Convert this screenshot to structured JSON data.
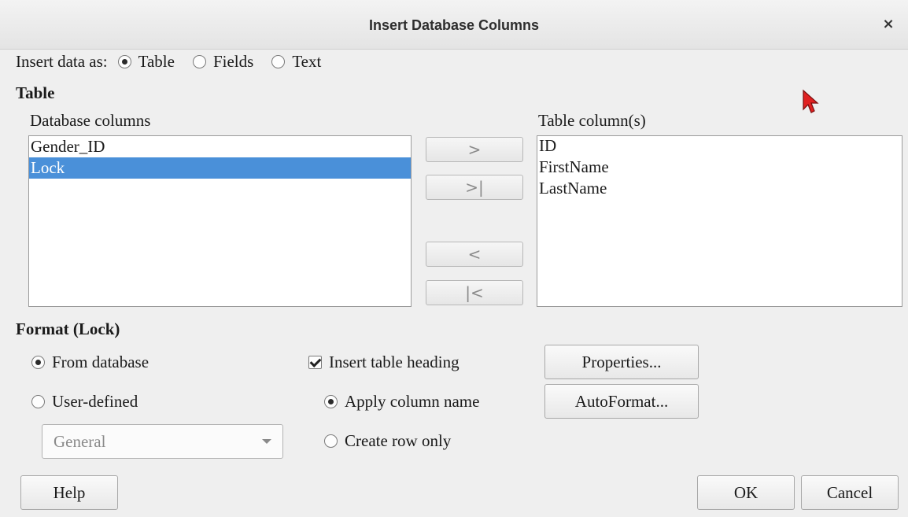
{
  "window": {
    "title": "Insert Database Columns",
    "close_symbol": "×"
  },
  "insert_as": {
    "label": "Insert data as:",
    "options": [
      {
        "label": "Table",
        "checked": true
      },
      {
        "label": "Fields",
        "checked": false
      },
      {
        "label": "Text",
        "checked": false
      }
    ]
  },
  "table_section": {
    "heading": "Table",
    "database_columns": {
      "label": "Database columns",
      "items": [
        "Gender_ID",
        "Lock"
      ],
      "selected_index": 1
    },
    "table_columns": {
      "label": "Table column(s)",
      "items": [
        "ID",
        "FirstName",
        "LastName"
      ]
    },
    "move_buttons": {
      "add_one": ">",
      "add_all": ">|",
      "remove_one": "<",
      "remove_all": "|<"
    }
  },
  "format_section": {
    "heading": "Format (Lock)",
    "from_database": {
      "label": "From database",
      "checked": true
    },
    "user_defined": {
      "label": "User-defined",
      "checked": false
    },
    "format_select": {
      "value": "General"
    },
    "insert_table_heading": {
      "label": "Insert table heading",
      "checked": true
    },
    "apply_column_name": {
      "label": "Apply column name",
      "checked": true
    },
    "create_row_only": {
      "label": "Create row only",
      "checked": false
    },
    "properties_button": "Properties...",
    "autoformat_button": "AutoFormat..."
  },
  "footer": {
    "help": "Help",
    "ok": "OK",
    "cancel": "Cancel"
  },
  "colors": {
    "selection": "#4a90d9",
    "dialog_bg": "#efefef",
    "cursor": "#e02020"
  },
  "icons": {
    "cursor": "pointer-arrow-icon"
  }
}
